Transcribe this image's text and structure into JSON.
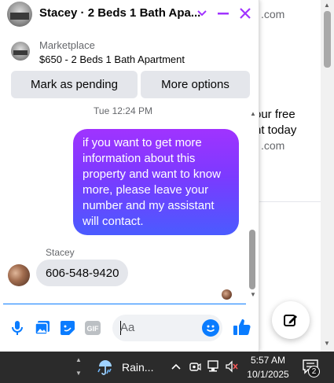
{
  "background_page": {
    "domain_fragment_1": ".com",
    "cta_line_1": "our free",
    "cta_line_2": "nt today",
    "domain_fragment_2": ".com"
  },
  "chat": {
    "title": "Stacey · 2 Beds 1 Bath Apa...",
    "header_icons": [
      "chevron-down-icon",
      "minimize-icon",
      "close-icon"
    ],
    "accent_color": "#a033ff",
    "listing": {
      "source": "Marketplace",
      "title": "$650 - 2 Beds 1 Bath Apartment"
    },
    "actions": {
      "mark_pending": "Mark as pending",
      "more_options": "More options"
    },
    "timestamp": "Tue 12:24 PM",
    "outgoing_message": "if you want to get more information about this property and want to know more, please leave your number and my assistant will contact.",
    "sender_name": "Stacey",
    "incoming_message": "606-548-9420",
    "composer": {
      "placeholder": "Aa",
      "icons": [
        "microphone-icon",
        "photo-icon",
        "sticker-icon",
        "gif-icon",
        "emoji-icon",
        "thumbs-up-icon"
      ],
      "gif_label": "GIF"
    },
    "primary_color": "#0a7cff"
  },
  "taskbar": {
    "weather": "Rain...",
    "time": "5:57 AM",
    "date": "10/1/2025",
    "notification_count": "2"
  }
}
